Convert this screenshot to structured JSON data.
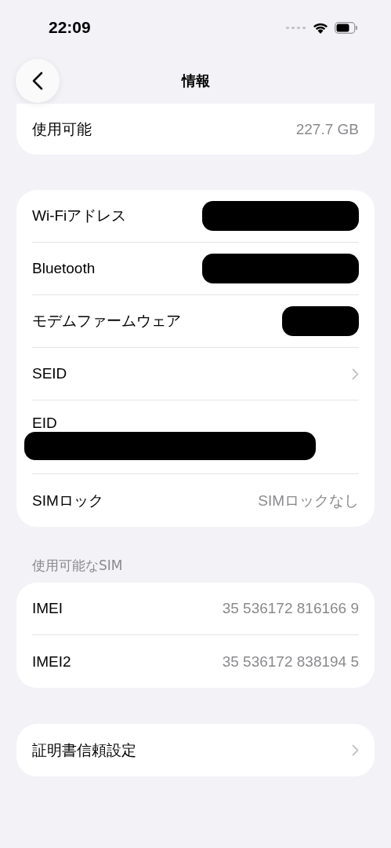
{
  "status_bar": {
    "time": "22:09"
  },
  "nav": {
    "title": "情報"
  },
  "storage": [
    {
      "label": "使用可能",
      "value": "227.7 GB",
      "kind": "value"
    }
  ],
  "info": [
    {
      "label": "Wi-Fiアドレス",
      "kind": "redacted"
    },
    {
      "label": "Bluetooth",
      "kind": "redacted"
    },
    {
      "label": "モデムファームウェア",
      "kind": "redacted-short"
    },
    {
      "label": "SEID",
      "kind": "chevron"
    },
    {
      "label": "EID",
      "kind": "stacked-redacted"
    },
    {
      "label": "SIMロック",
      "value": "SIMロックなし",
      "kind": "value"
    }
  ],
  "sim_section": {
    "header": "使用可能なSIM",
    "rows": [
      {
        "label": "IMEI",
        "value": "35 536172 816166 9",
        "kind": "value"
      },
      {
        "label": "IMEI2",
        "value": "35 536172 838194 5",
        "kind": "value"
      }
    ]
  },
  "certificates": [
    {
      "label": "証明書信頼設定",
      "kind": "chevron"
    }
  ]
}
